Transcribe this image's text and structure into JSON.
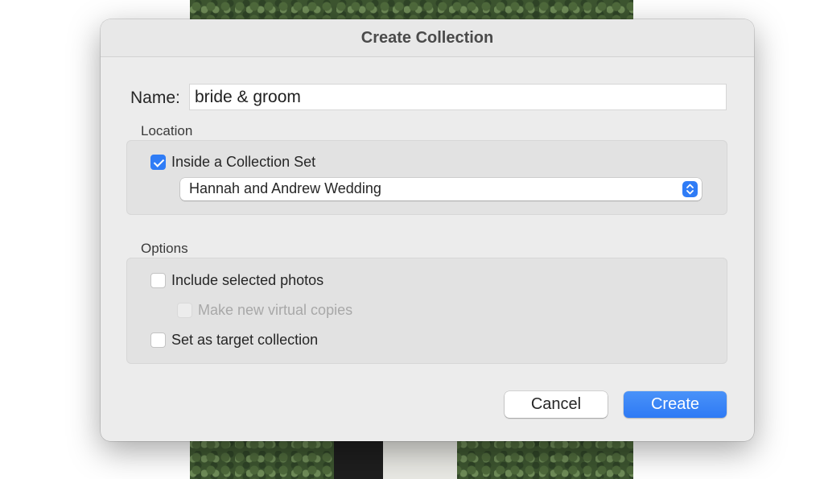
{
  "dialog": {
    "title": "Create Collection"
  },
  "name_field": {
    "label": "Name:",
    "value": "bride & groom"
  },
  "location": {
    "heading": "Location",
    "inside_collection_set": {
      "label": "Inside a Collection Set",
      "checked": true
    },
    "collection_set_select": {
      "selected": "Hannah and Andrew Wedding"
    }
  },
  "options": {
    "heading": "Options",
    "include_selected_photos": {
      "label": "Include selected photos",
      "checked": false
    },
    "make_virtual_copies": {
      "label": "Make new virtual copies",
      "checked": false,
      "enabled": false
    },
    "set_as_target": {
      "label": "Set as target collection",
      "checked": false
    }
  },
  "buttons": {
    "cancel": "Cancel",
    "create": "Create"
  },
  "colors": {
    "accent": "#2f7cf6",
    "dialog_background": "#ececec",
    "group_background": "#e2e2e2"
  },
  "icons": {
    "checkmark": "checkmark-icon",
    "select_stepper": "up-down-chevron-icon"
  }
}
